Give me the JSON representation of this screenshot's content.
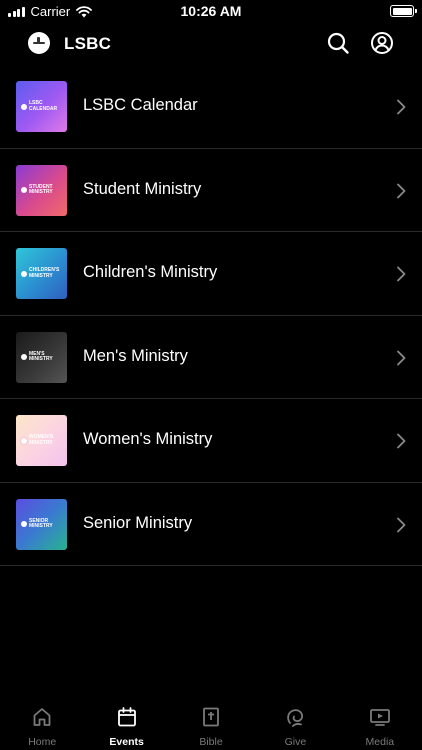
{
  "status_bar": {
    "carrier": "Carrier",
    "time": "10:26 AM"
  },
  "header": {
    "title": "LSBC",
    "icons": [
      "logo-icon",
      "search-icon",
      "account-icon"
    ]
  },
  "list": {
    "items": [
      {
        "label": "LSBC Calendar",
        "thumb_text": "LSBC CALENDAR",
        "gradient": "purple"
      },
      {
        "label": "Student Ministry",
        "thumb_text": "STUDENT MINISTRY",
        "gradient": "pink"
      },
      {
        "label": "Children's Ministry",
        "thumb_text": "CHILDREN'S MINISTRY",
        "gradient": "cyan"
      },
      {
        "label": "Men's Ministry",
        "thumb_text": "MEN'S MINISTRY",
        "gradient": "dark"
      },
      {
        "label": "Women's Ministry",
        "thumb_text": "WOMEN'S MINISTRY",
        "gradient": "peach"
      },
      {
        "label": "Senior Ministry",
        "thumb_text": "SENIOR MINISTRY",
        "gradient": "teal"
      }
    ]
  },
  "tab_bar": {
    "tabs": [
      {
        "label": "Home",
        "icon": "home-icon",
        "active": false
      },
      {
        "label": "Events",
        "icon": "calendar-icon",
        "active": true
      },
      {
        "label": "Bible",
        "icon": "bible-icon",
        "active": false
      },
      {
        "label": "Give",
        "icon": "give-icon",
        "active": false
      },
      {
        "label": "Media",
        "icon": "media-icon",
        "active": false
      }
    ]
  },
  "colors": {
    "background": "#000000",
    "divider": "#2a2a2a",
    "tab_inactive": "#7a7a7a",
    "tab_active": "#ffffff"
  }
}
